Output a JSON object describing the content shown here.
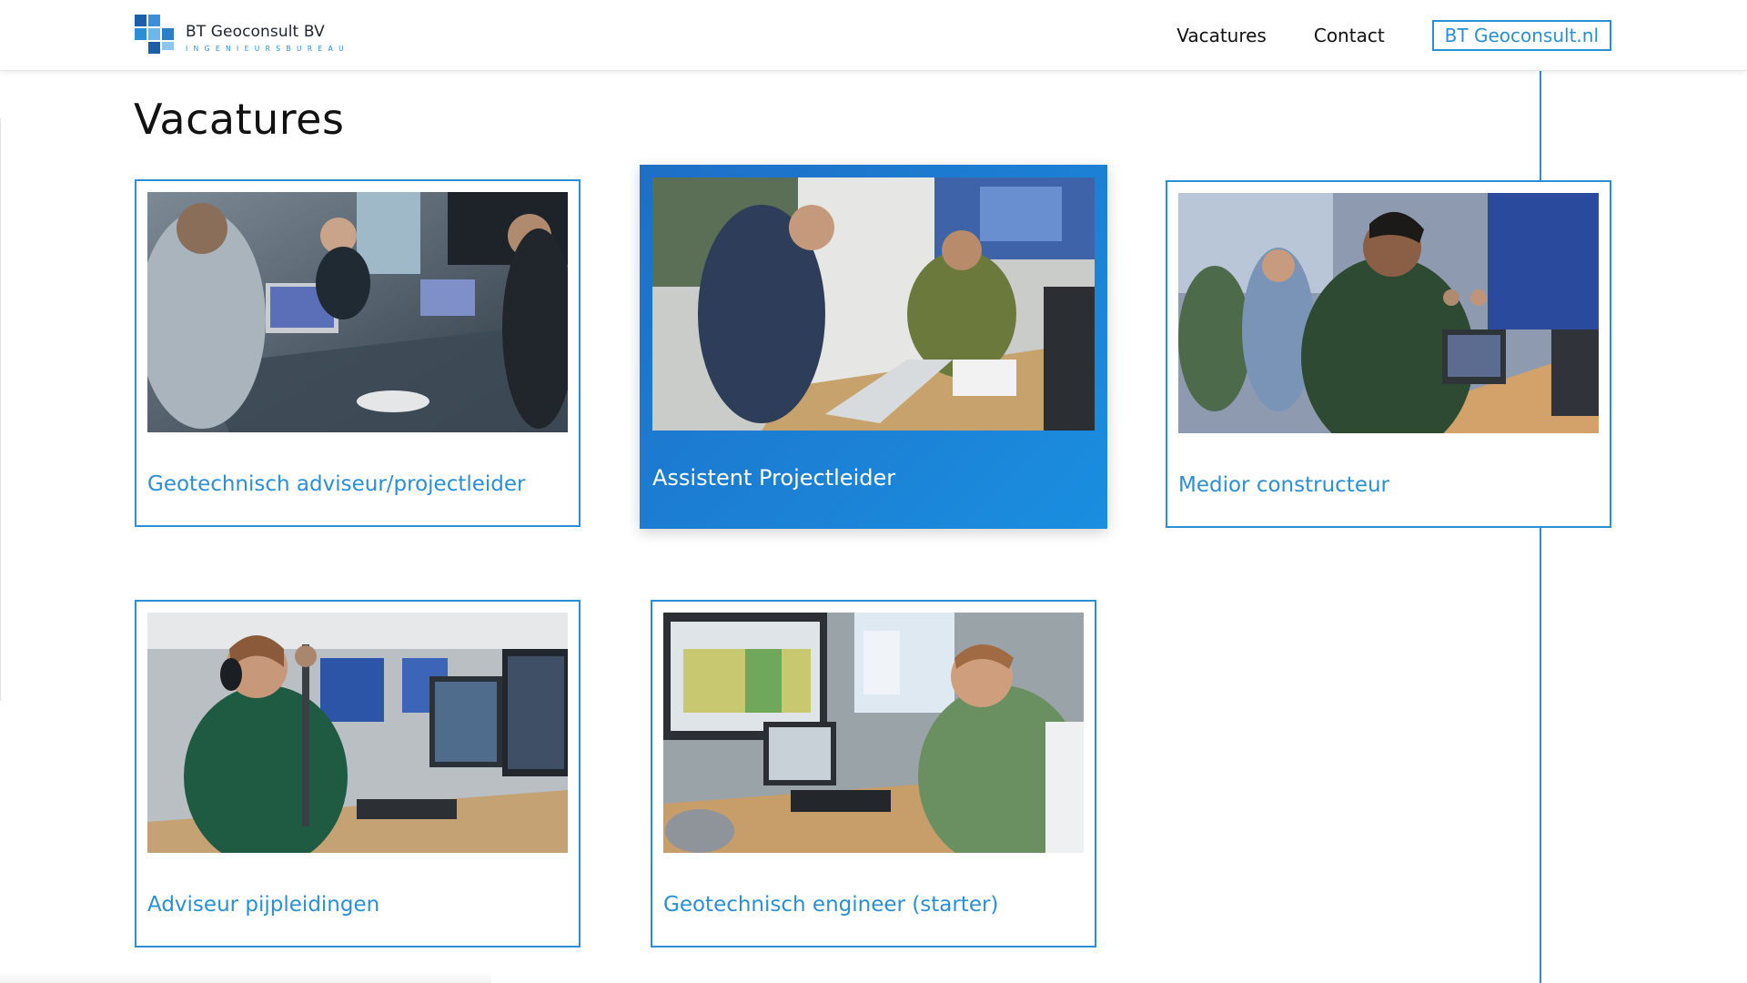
{
  "brand": {
    "name": "BT Geoconsult BV",
    "tagline": "INGENIEURSBUREAU",
    "colors": {
      "primary": "#2a8fd4",
      "dark": "#1e6fc6"
    }
  },
  "nav": {
    "vacatures": "Vacatures",
    "contact": "Contact",
    "site": "BT Geoconsult.nl"
  },
  "page": {
    "title": "Vacatures"
  },
  "cards": [
    {
      "title": "Geotechnisch adviseur/projectleider",
      "image": "meeting-room-photo",
      "active": false
    },
    {
      "title": "Assistent Projectleider",
      "image": "office-discussion-photo",
      "active": true
    },
    {
      "title": "Medior constructeur",
      "image": "conference-table-photo",
      "active": false
    },
    {
      "title": "Adviseur pijpleidingen",
      "image": "desk-monitors-photo",
      "active": false
    },
    {
      "title": "Geotechnisch engineer (starter)",
      "image": "engineer-desk-photo",
      "active": false
    }
  ]
}
